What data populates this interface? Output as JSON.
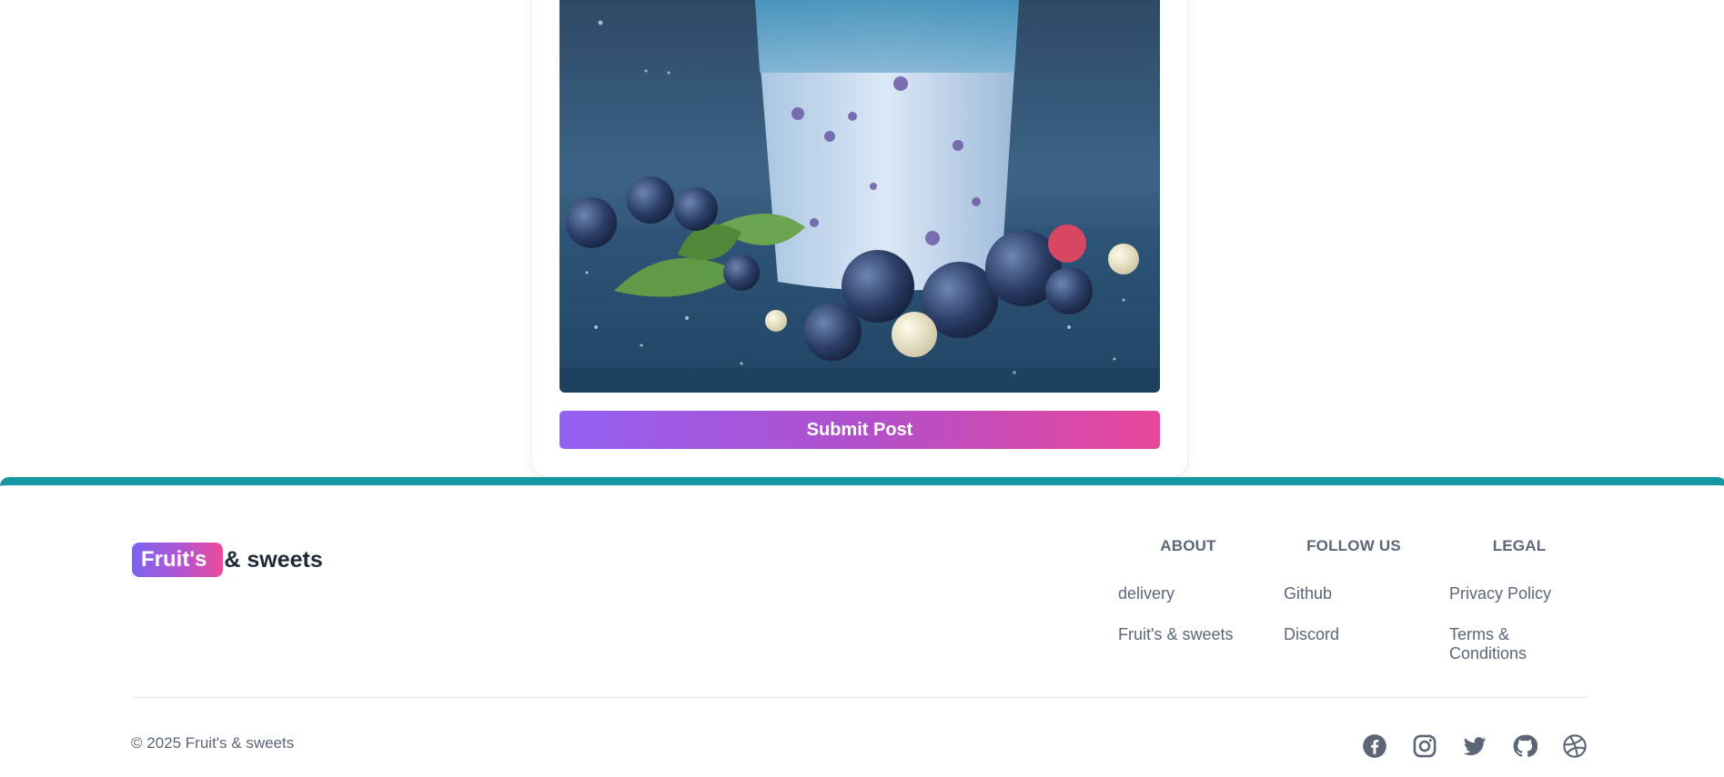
{
  "post_form": {
    "image_alt": "blueberry smoothie",
    "submit_label": "Submit Post"
  },
  "footer": {
    "brand": {
      "badge": "Fruit's",
      "text": "& sweets"
    },
    "columns": [
      {
        "heading": "ABOUT",
        "links": [
          "delivery",
          "Fruit's & sweets"
        ]
      },
      {
        "heading": "FOLLOW US",
        "links": [
          "Github",
          "Discord"
        ]
      },
      {
        "heading": "LEGAL",
        "links": [
          "Privacy Policy",
          "Terms & Conditions"
        ]
      }
    ],
    "copyright": "© 2025 Fruit's & sweets",
    "social_icons": [
      "facebook-icon",
      "instagram-icon",
      "twitter-icon",
      "github-icon",
      "dribbble-icon"
    ]
  },
  "colors": {
    "accent_teal": "#1696a3",
    "gradient_start": "#9361f2",
    "gradient_end": "#e8479a",
    "text_muted": "#5c6677",
    "text_dark": "#1f2937"
  }
}
